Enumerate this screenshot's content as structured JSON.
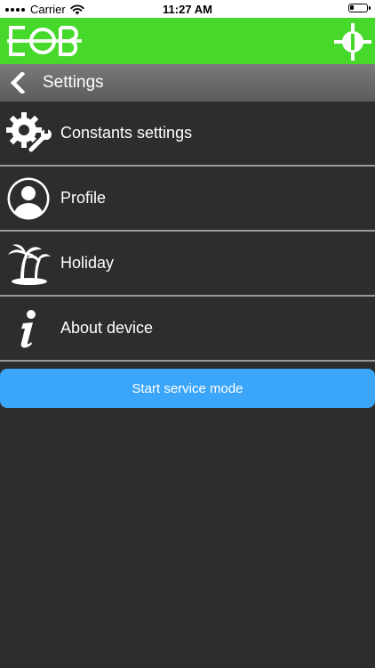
{
  "status_bar": {
    "carrier": "Carrier",
    "time": "11:27 AM",
    "wifi_icon": "wifi-icon",
    "battery_icon": "battery-icon"
  },
  "app_bar": {
    "logo_text": "EOB",
    "target_icon": "crosshair-target-icon",
    "colors": {
      "background": "#46d92b"
    }
  },
  "title_bar": {
    "back_icon": "chevron-left-icon",
    "title": "Settings"
  },
  "menu": {
    "items": [
      {
        "label": "Constants settings",
        "icon": "gear-wrench-icon"
      },
      {
        "label": "Profile",
        "icon": "user-profile-icon"
      },
      {
        "label": "Holiday",
        "icon": "palm-tree-icon"
      },
      {
        "label": "About device",
        "icon": "info-icon"
      }
    ]
  },
  "service_button": {
    "label": "Start service mode",
    "color": "#3ba5f9"
  }
}
